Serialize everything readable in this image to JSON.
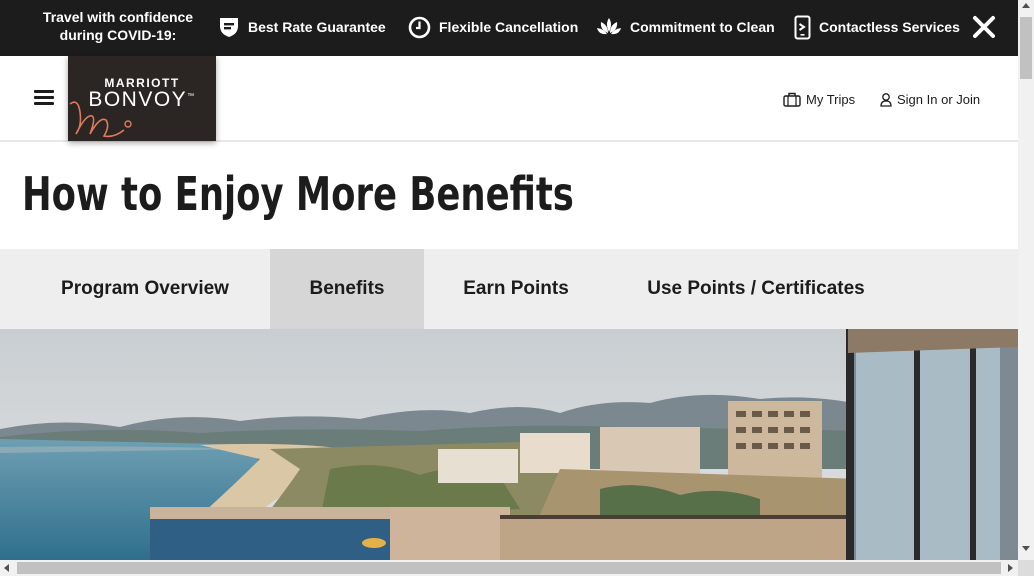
{
  "covid_banner": {
    "intro": "Travel with confidence during COVID-19:",
    "items": [
      {
        "label": "Best Rate Guarantee",
        "icon": "rate-flag-icon"
      },
      {
        "label": "Flexible Cancellation",
        "icon": "clock-icon"
      },
      {
        "label": "Commitment to Clean",
        "icon": "lotus-icon"
      },
      {
        "label": "Contactless Services",
        "icon": "mobile-phone-icon"
      }
    ],
    "close_icon": "close-icon"
  },
  "header": {
    "logo_line1": "MARRIOTT",
    "logo_line2": "BONVOY",
    "logo_tm": "™",
    "my_trips": "My Trips",
    "sign_in": "Sign In or Join"
  },
  "page": {
    "title": "How to Enjoy More Benefits"
  },
  "tabs": [
    {
      "label": "Program Overview",
      "active": false
    },
    {
      "label": "Benefits",
      "active": true
    },
    {
      "label": "Earn Points",
      "active": false
    },
    {
      "label": "Use Points / Certificates",
      "active": false
    }
  ],
  "colors": {
    "banner_bg": "#1c1c1c",
    "logo_bg": "#2b2523",
    "logo_accent": "#e07a5f",
    "tab_bar_bg": "#eeeeee",
    "tab_active_bg": "#d6d6d6",
    "text": "#1c1c1c"
  }
}
